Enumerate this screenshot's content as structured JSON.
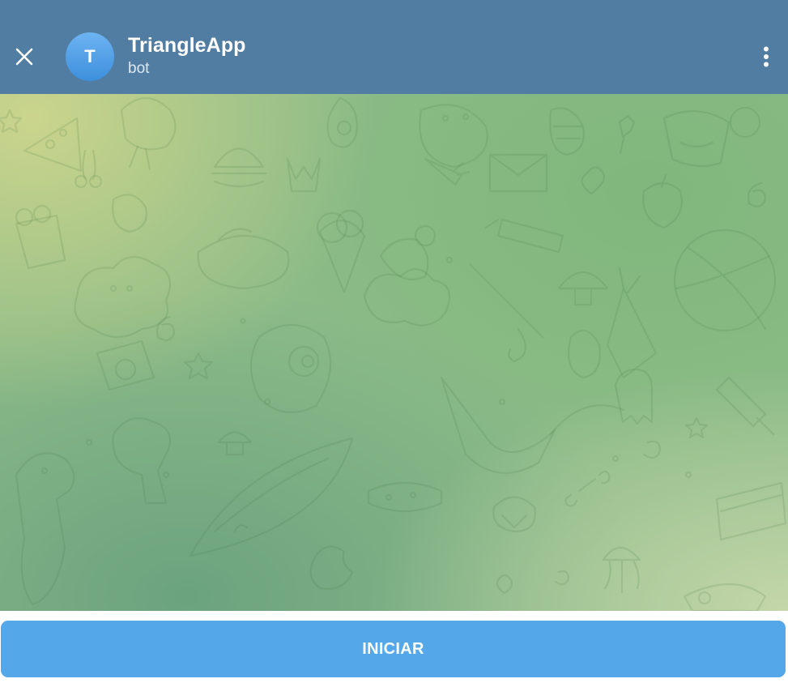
{
  "header": {
    "avatar_initial": "T",
    "title": "TriangleApp",
    "subtitle": "bot",
    "background_color": "#517da2",
    "close_icon": "close-icon",
    "menu_icon": "more-vertical-icon"
  },
  "chat": {
    "background_style": "doodle-pattern-green-gradient"
  },
  "bottom": {
    "start_button_label": "INICIAR",
    "button_color": "#54a7e8"
  }
}
